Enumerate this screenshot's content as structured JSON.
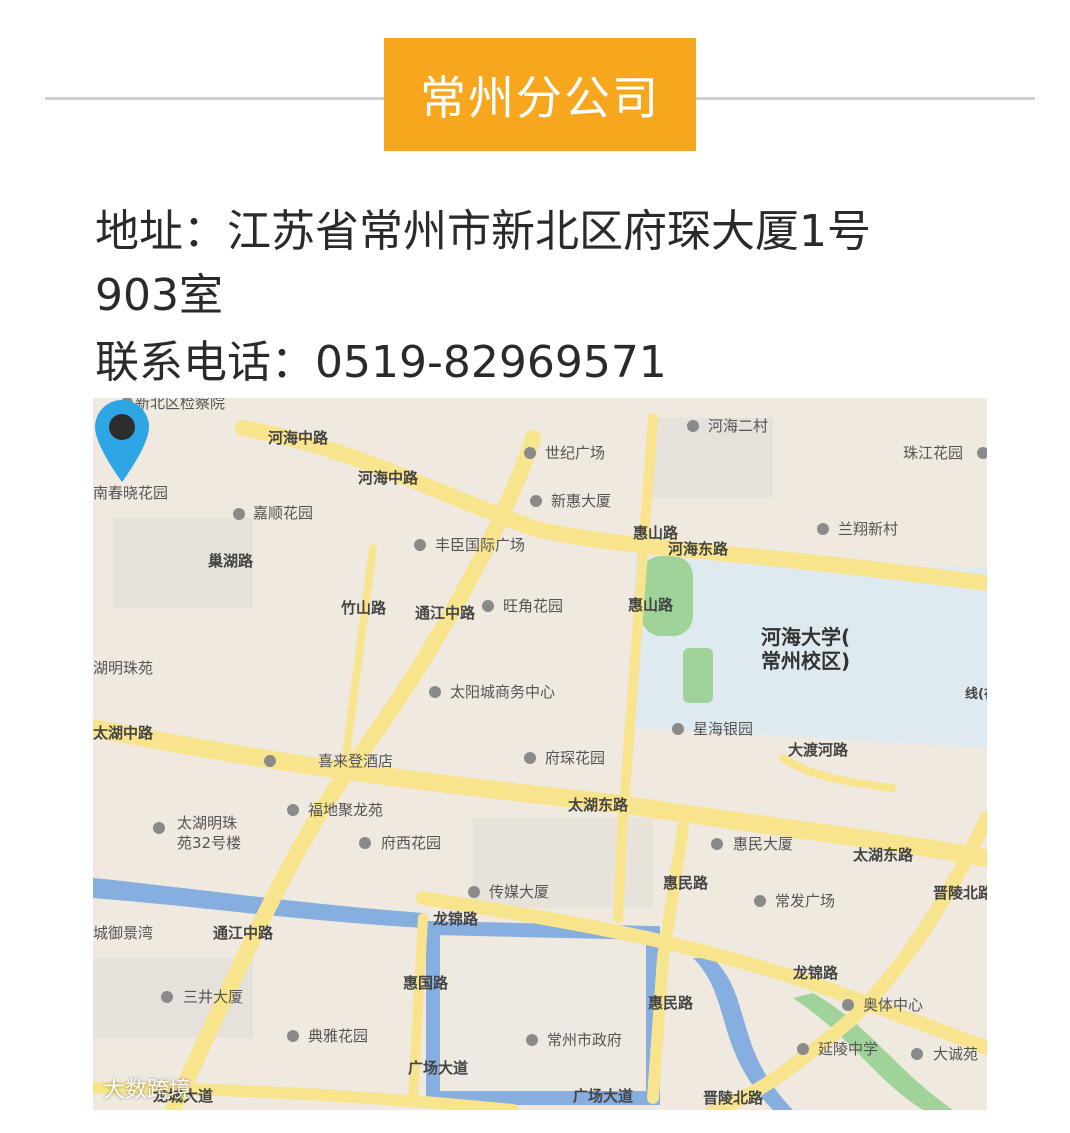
{
  "header": {
    "title": "常州分公司"
  },
  "contact": {
    "address_line1": "地址：江苏省常州市新北区府琛大厦1号",
    "address_line2": "903室",
    "phone_line": "联系电话：0519-82969571"
  },
  "map": {
    "road_labels": [
      "河海中路",
      "河海中路",
      "巢湖路",
      "竹山路",
      "通江中路",
      "河海东路",
      "惠山路",
      "惠山路",
      "太湖中路",
      "太湖东路",
      "太湖东路",
      "大渡河路",
      "惠民路",
      "晋陵北路",
      "龙锦路",
      "龙锦路",
      "惠国路",
      "惠民路",
      "通江中路",
      "广场大道",
      "广场大道",
      "晋陵北路",
      "龙城大道",
      "线(在建)"
    ],
    "poi_labels": [
      "新北区检察院",
      "世纪广场",
      "河海二村",
      "珠江花园",
      "南春晓花园",
      "嘉顺花园",
      "新惠大厦",
      "兰翔新村",
      "丰臣国际广场",
      "旺角花园",
      "湖明珠苑",
      "太阳城商务中心",
      "星海银园",
      "府琛花园",
      "喜来登酒店",
      "福地聚龙苑",
      "太湖明珠",
      "苑32号楼",
      "府西花园",
      "惠民大厦",
      "传媒大厦",
      "常发广场",
      "城御景湾",
      "三井大厦",
      "奥体中心",
      "典雅花园",
      "常州市政府",
      "延陵中学",
      "大诚苑"
    ],
    "district_label_1": "河海大学(",
    "district_label_2": "常州校区)",
    "colors": {
      "road": "#f7e48d",
      "road_edge": "#e8c95a",
      "water": "#86aede",
      "green": "#9fd39a",
      "campus": "#dfeaf0",
      "pin": "#2ea6e6"
    }
  },
  "watermark": {
    "text": "大数跨境"
  }
}
